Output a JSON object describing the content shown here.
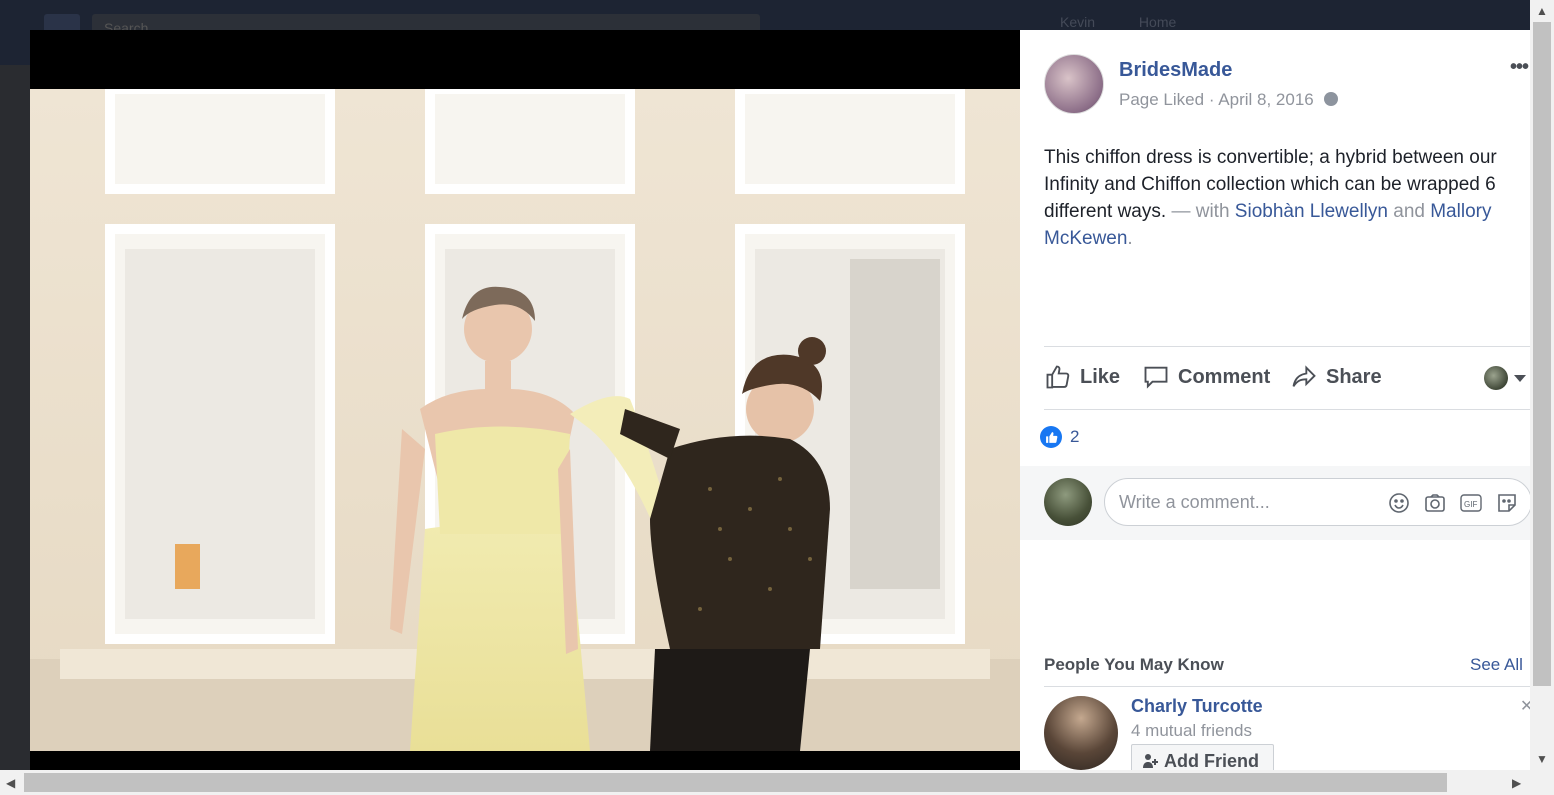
{
  "topbar": {
    "search_placeholder": "Search",
    "user_name": "Kevin",
    "home_label": "Home"
  },
  "post": {
    "page_name": "BridesMade",
    "status": "Page Liked",
    "separator": "·",
    "date": "April 8, 2016",
    "more_label": "•••",
    "text_main": "This chiffon dress is convertible; a hybrid between our Infinity and Chiffon collection which can be wrapped 6 different ways.",
    "with_prefix": "— with",
    "tagged_1": "Siobhàn Llewellyn",
    "and_word": "and",
    "tagged_2": "Mallory McKewen",
    "period": "."
  },
  "actions": {
    "like": "Like",
    "comment": "Comment",
    "share": "Share"
  },
  "reactions": {
    "count": "2"
  },
  "comment_box": {
    "placeholder": "Write a comment..."
  },
  "pymk": {
    "title": "People You May Know",
    "see_all": "See All",
    "person": {
      "name": "Charly Turcotte",
      "mutual": "4 mutual friends",
      "add_friend": "Add Friend"
    }
  },
  "colors": {
    "link": "#385898",
    "like_blue": "#1877f2",
    "text": "#1d2129",
    "muted": "#90949c"
  }
}
